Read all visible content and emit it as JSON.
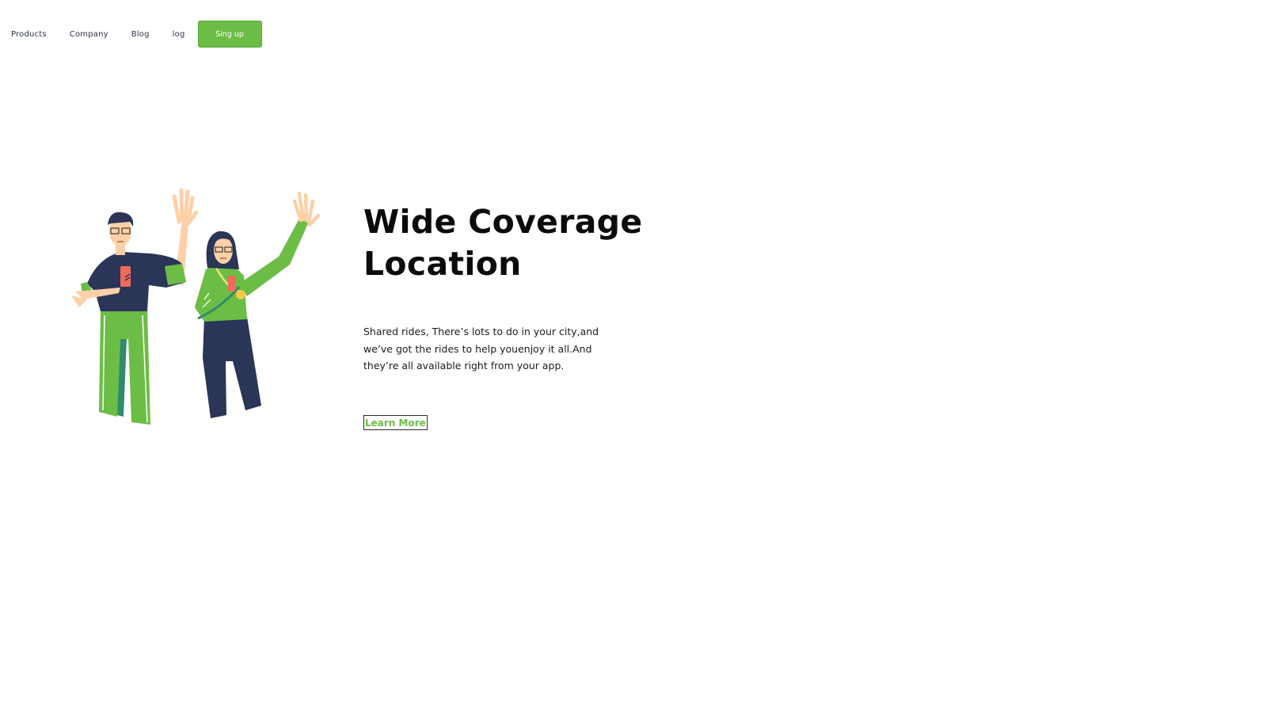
{
  "nav": {
    "products": "Products",
    "company": "Company",
    "blog": "Blog",
    "log": "log",
    "signup": "Sing up"
  },
  "hero": {
    "title": "Wide Coverage Location",
    "description": "Shared rides, There’s lots to do in your city,and we’ve got the rides to help youenjoy it all.And they’re all available right from your app.",
    "cta": "Learn More"
  },
  "colors": {
    "accent": "#6cbd45",
    "navy": "#2a3557",
    "skin": "#fdd0a8",
    "phone": "#f26a5a"
  },
  "illustration": "two-people-waving-illustration"
}
